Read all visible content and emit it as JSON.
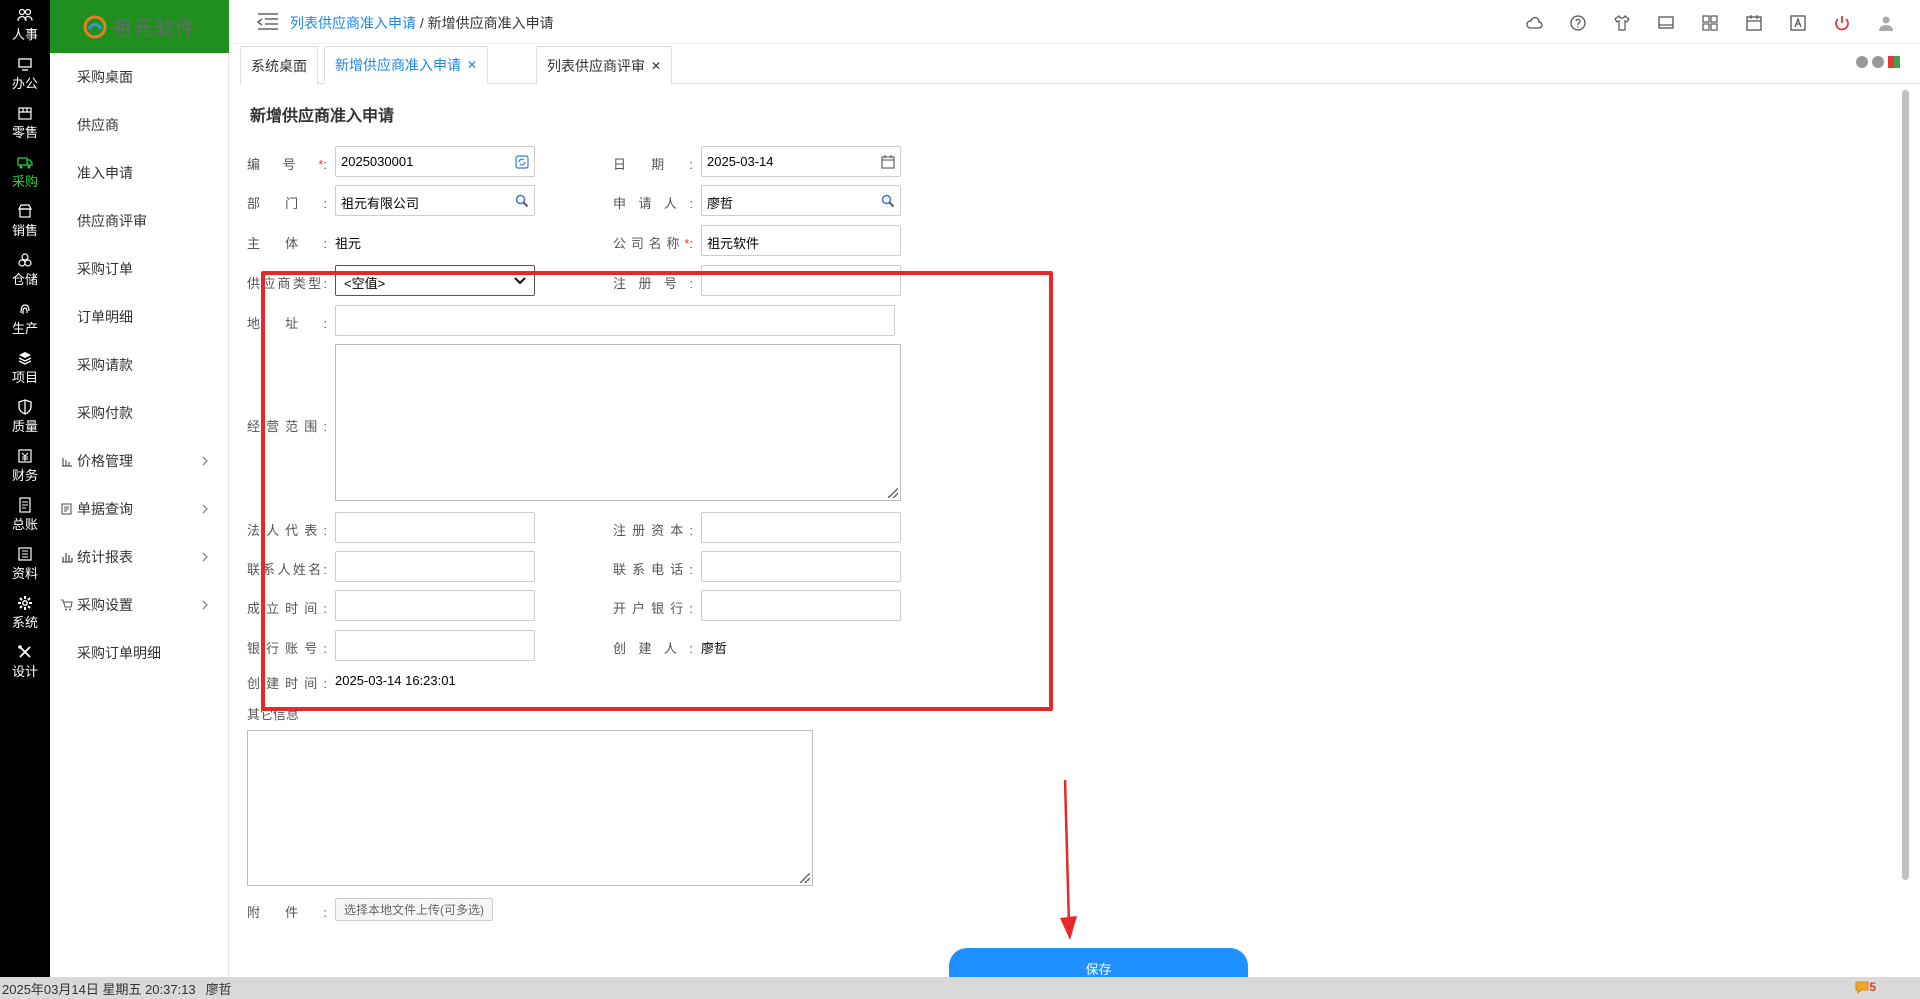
{
  "modules": [
    {
      "label": "人事",
      "icon": "people-icon"
    },
    {
      "label": "办公",
      "icon": "monitor-icon"
    },
    {
      "label": "零售",
      "icon": "store-icon"
    },
    {
      "label": "采购",
      "icon": "truck-icon",
      "active": true
    },
    {
      "label": "销售",
      "icon": "shop-icon"
    },
    {
      "label": "仓储",
      "icon": "boxes-icon"
    },
    {
      "label": "生产",
      "icon": "fingerprint-icon"
    },
    {
      "label": "项目",
      "icon": "layers-icon"
    },
    {
      "label": "质量",
      "icon": "shield-icon"
    },
    {
      "label": "财务",
      "icon": "money-icon"
    },
    {
      "label": "总账",
      "icon": "ledger-icon"
    },
    {
      "label": "资料",
      "icon": "list-icon"
    },
    {
      "label": "系统",
      "icon": "gear-icon"
    },
    {
      "label": "设计",
      "icon": "tools-icon"
    }
  ],
  "logo": {
    "text": "祖元软件"
  },
  "submenu": {
    "items": [
      {
        "label": "采购桌面"
      },
      {
        "label": "供应商"
      },
      {
        "label": "准入申请"
      },
      {
        "label": "供应商评审"
      },
      {
        "label": "采购订单"
      },
      {
        "label": "订单明细"
      },
      {
        "label": "采购请款"
      },
      {
        "label": "采购付款"
      }
    ],
    "groups": [
      {
        "label": "价格管理"
      },
      {
        "label": "单据查询"
      },
      {
        "label": "统计报表"
      },
      {
        "label": "采购设置"
      }
    ],
    "last": {
      "label": "采购订单明细"
    }
  },
  "breadcrumb": {
    "link": "列表供应商准入申请",
    "sep": " / ",
    "current": "新增供应商准入申请"
  },
  "tabs": [
    {
      "label": "系统桌面"
    },
    {
      "label": "新增供应商准入申请"
    },
    {
      "label": "列表供应商评审"
    }
  ],
  "tab_close": "✕",
  "form": {
    "title": "新增供应商准入申请",
    "labels": {
      "code": "编号",
      "date": "日期",
      "dept": "部门",
      "applicant": "申请人",
      "subject": "主体",
      "company": "公司名称",
      "supplier_type": "供应商类型",
      "reg_no": "注册号",
      "address": "地址",
      "scope": "经营范围",
      "legal_rep": "法人代表",
      "reg_capital": "注册资本",
      "contact_name": "联系人姓名",
      "contact_phone": "联系电话",
      "founded": "成立时间",
      "bank": "开户银行",
      "bank_account": "银行账号",
      "creator": "创建人",
      "created_time": "创建时间",
      "other": "其它信息",
      "attachment": "附件"
    },
    "colon": ":",
    "required_mark": "*",
    "values": {
      "code": "2025030001",
      "date": "2025-03-14",
      "dept": "祖元有限公司",
      "applicant": "廖哲",
      "subject": "祖元",
      "company": "祖元软件",
      "supplier_type": "<空值>",
      "creator": "廖哲",
      "created_time": "2025-03-14 16:23:01"
    },
    "upload_label": "选择本地文件上传(可多选)",
    "save_label": "保存"
  },
  "status": {
    "datetime": "2025年03月14日 星期五 20:37:13",
    "user": "廖哲",
    "notifications": "5"
  },
  "colors": {
    "annotation": "#e8272b",
    "accent": "#1e88e5",
    "active_module": "#2ecc40",
    "logo_bg": "#1f8f1f"
  }
}
